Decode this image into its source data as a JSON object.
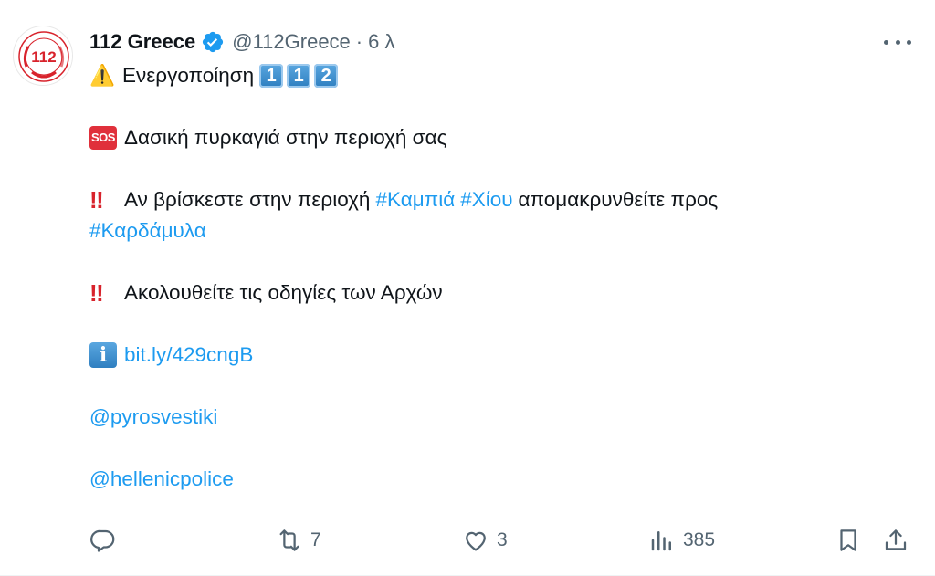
{
  "tweet": {
    "author": {
      "display_name": "112 Greece",
      "handle": "@112Greece",
      "separator": "·",
      "time": "6 λ",
      "avatar_text": "112"
    },
    "body": {
      "line1": {
        "emoji": "⚠️",
        "text": "Ενεργοποίηση",
        "keycaps": [
          "1",
          "1",
          "2"
        ]
      },
      "line2": {
        "emoji": "SOS",
        "text": "Δασική πυρκαγιά στην περιοχή σας"
      },
      "line3": {
        "emoji": "‼",
        "text_before": "Αν βρίσκεστε στην περιοχή",
        "hashtag1": "#Καμπιά",
        "hashtag2": "#Χίου",
        "text_after": "απομακρυνθείτε προς",
        "hashtag3": "#Καρδάμυλα"
      },
      "line4": {
        "emoji": "‼",
        "text": "Ακολουθείτε τις οδηγίες των Αρχών"
      },
      "line5": {
        "emoji": "i",
        "link": "bit.ly/429cngB"
      },
      "mention1": "@pyrosvestiki",
      "mention2": "@hellenicpolice"
    },
    "actions": {
      "reply_count": "",
      "retweet_count": "7",
      "like_count": "3",
      "views_count": "385"
    }
  },
  "icons": {
    "verified": "verified-badge-icon",
    "more": "more-icon",
    "reply": "reply-icon",
    "retweet": "retweet-icon",
    "like": "heart-icon",
    "views": "views-icon",
    "bookmark": "bookmark-icon",
    "share": "share-icon"
  },
  "colors": {
    "link": "#1d9bf0",
    "secondary_text": "#536471",
    "primary_text": "#0f1419",
    "verified": "#1d9bf0",
    "logo_red": "#d8232c"
  }
}
